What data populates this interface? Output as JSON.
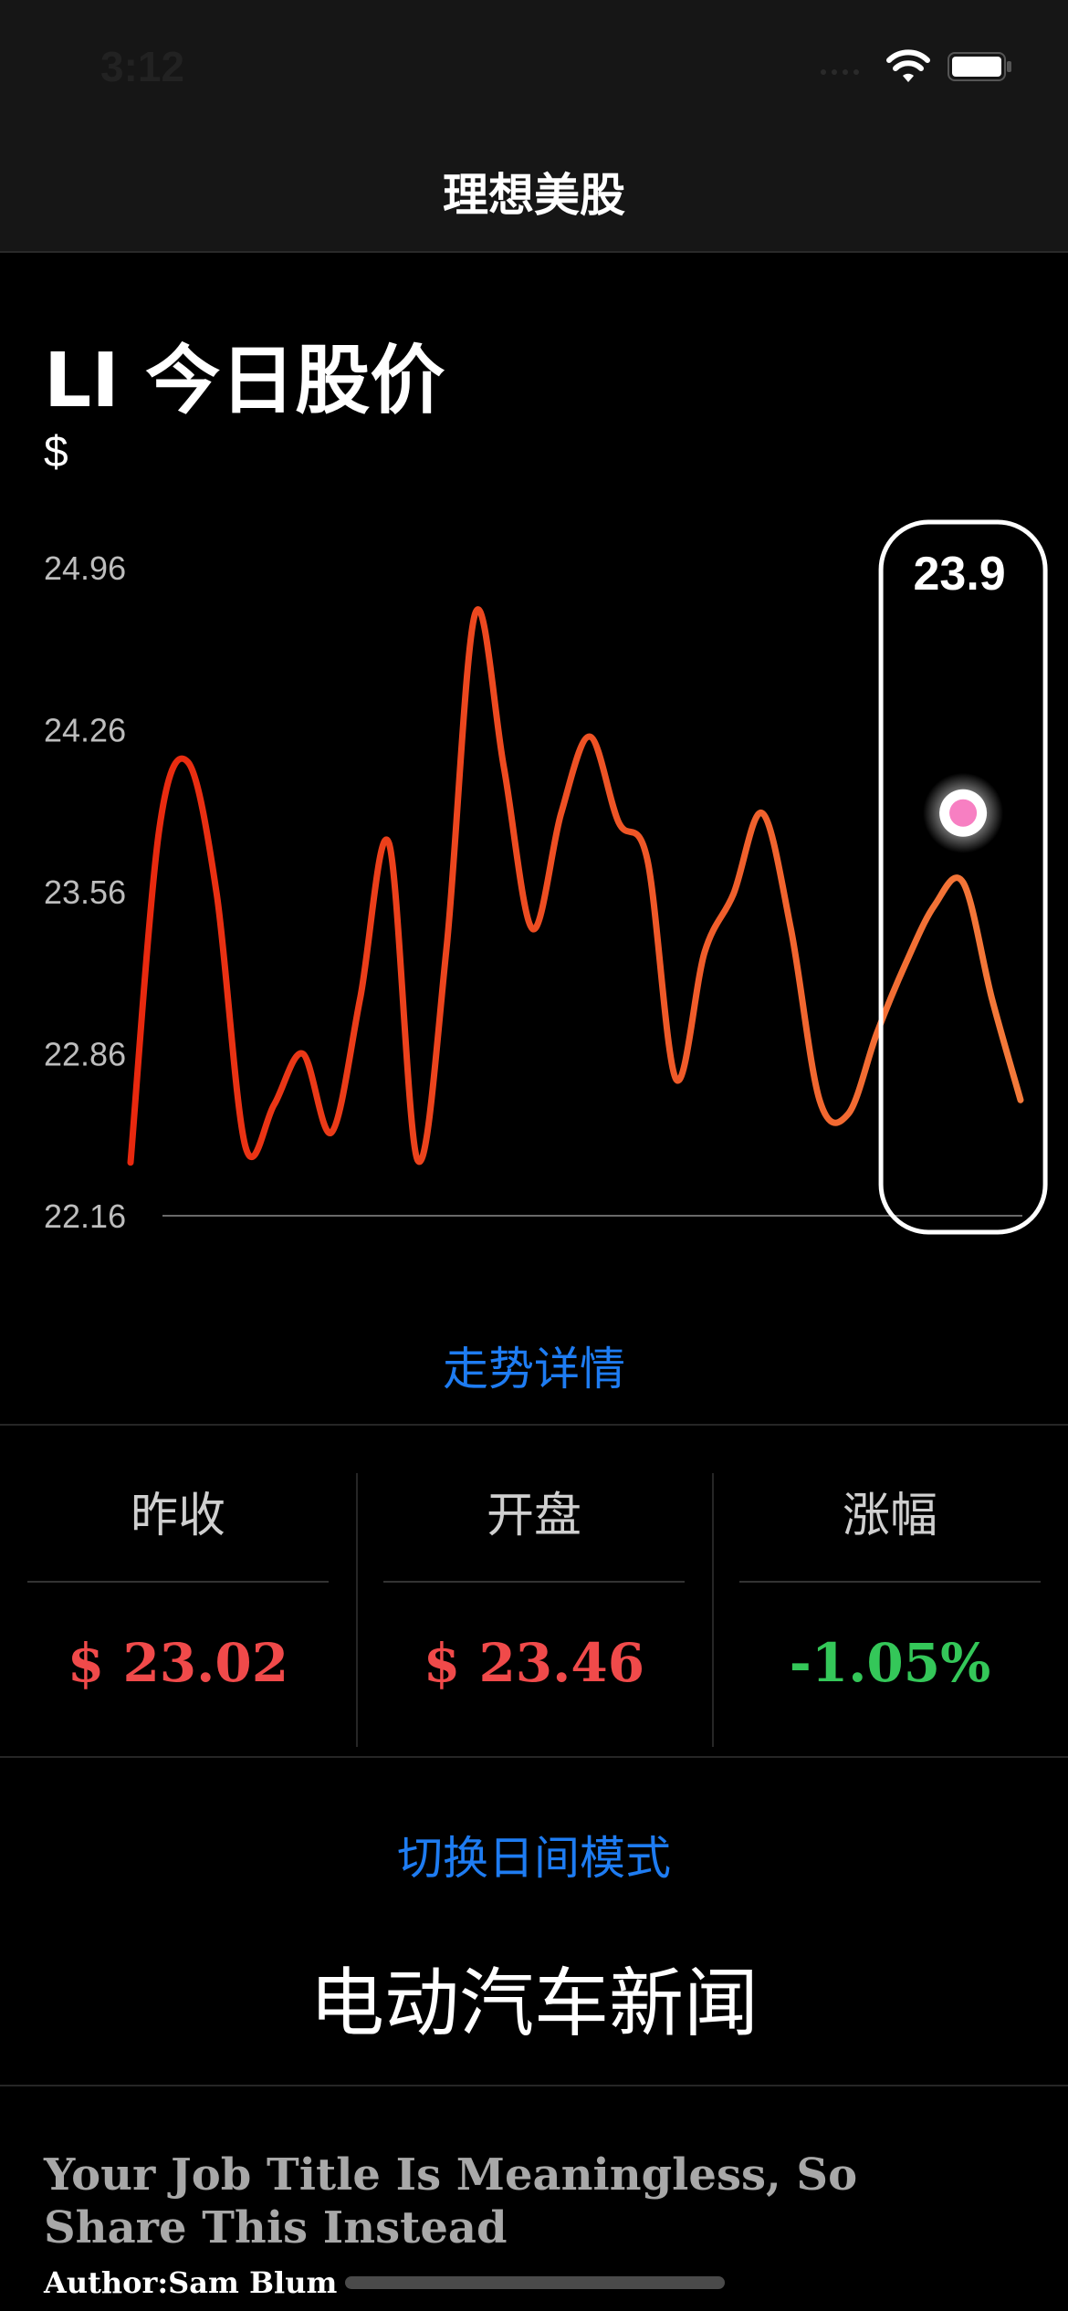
{
  "status_bar": {
    "time": "3:12"
  },
  "nav": {
    "title": "理想美股"
  },
  "header": {
    "title": "LI 今日股价",
    "currency": "$"
  },
  "chart_data": {
    "type": "line",
    "y_ticks": [
      "24.96",
      "24.26",
      "23.56",
      "22.86",
      "22.16"
    ],
    "ylim": [
      22.16,
      24.96
    ],
    "x": [
      0,
      1,
      2,
      3,
      4,
      5,
      6,
      7,
      8,
      9,
      10,
      11,
      12,
      13,
      14,
      15,
      16,
      17,
      18,
      19,
      20,
      21,
      22,
      23,
      24,
      25,
      26,
      27,
      28,
      29,
      30,
      31
    ],
    "values": [
      22.39,
      23.83,
      24.12,
      23.55,
      22.46,
      22.64,
      22.86,
      22.52,
      23.1,
      23.77,
      22.4,
      23.31,
      24.76,
      24.1,
      23.4,
      23.9,
      24.23,
      23.86,
      23.7,
      22.75,
      23.3,
      23.55,
      23.9,
      23.4,
      22.66,
      22.6,
      22.95,
      23.25,
      23.5,
      23.6,
      23.1,
      22.66
    ],
    "selected": {
      "index": 29,
      "value": "23.9"
    },
    "colors": {
      "start": "#e8280e",
      "end": "#f47a3a",
      "marker": "#f77fc2"
    }
  },
  "actions": {
    "trend_details": "走势详情",
    "toggle_mode": "切换日间模式"
  },
  "stats": [
    {
      "label": "昨收",
      "value": "$ 23.02",
      "color": "#f04a4a"
    },
    {
      "label": "开盘",
      "value": "$ 23.46",
      "color": "#f04a4a"
    },
    {
      "label": "涨幅",
      "value": "-1.05%",
      "color": "#34c759"
    }
  ],
  "news": {
    "section_title": "电动汽车新闻",
    "article_title": "Your Job Title Is Meaningless, So Share This Instead",
    "article_author": "Author:Sam Blum"
  }
}
